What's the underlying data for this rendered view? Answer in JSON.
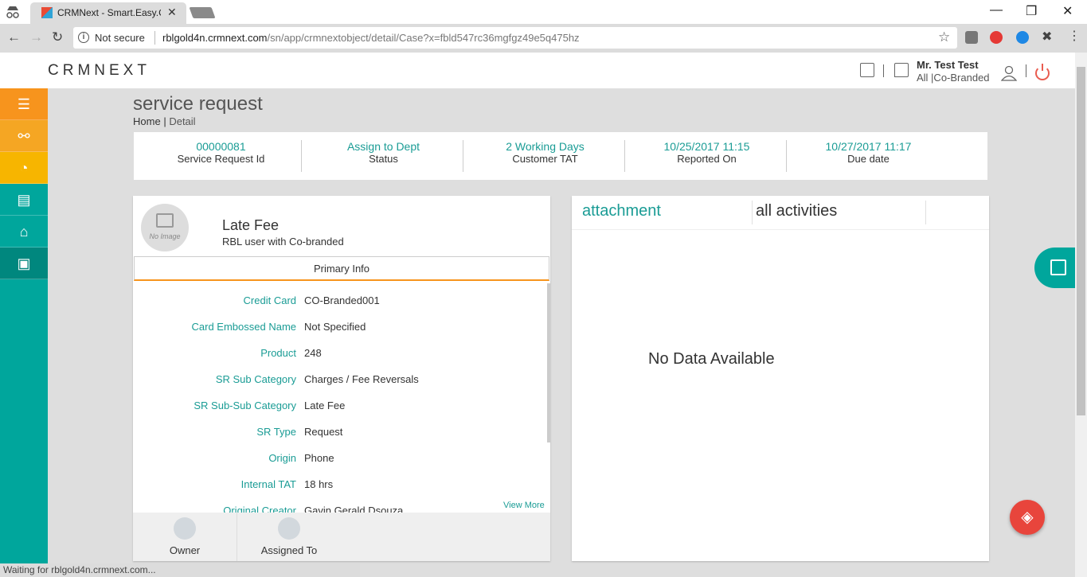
{
  "browser": {
    "tab_title": "CRMNext - Smart.Easy.Co",
    "security": "Not secure",
    "url_host": "rblgold4n.crmnext.com",
    "url_path": "/sn/app/crmnextobject/detail/Case?x=fbld547rc36mgfgz49e5q475hz",
    "status_text": "Waiting for rblgold4n.crmnext.com..."
  },
  "header": {
    "logo": "CRMNEXT",
    "user_name": "Mr. Test Test",
    "user_role": "All |Co-Branded"
  },
  "page": {
    "title": "service request",
    "breadcrumb_home": "Home",
    "breadcrumb_sep": "|",
    "breadcrumb_current": "Detail"
  },
  "summary": [
    {
      "value": "00000081",
      "label": "Service Request Id"
    },
    {
      "value": "Assign to Dept",
      "label": "Status"
    },
    {
      "value": "2 Working Days",
      "label": "Customer TAT"
    },
    {
      "value": "10/25/2017 11:15",
      "label": "Reported On"
    },
    {
      "value": "10/27/2017 11:17",
      "label": "Due date"
    }
  ],
  "record": {
    "no_image": "No Image",
    "subject": "Late Fee",
    "subtitle": "RBL user with Co-branded",
    "tab": "Primary Info",
    "fields": [
      {
        "label": "Credit Card",
        "value": "CO-Branded001"
      },
      {
        "label": "Card Embossed Name",
        "value": "Not Specified"
      },
      {
        "label": "Product",
        "value": "248"
      },
      {
        "label": "SR Sub Category",
        "value": "Charges / Fee Reversals"
      },
      {
        "label": "SR Sub-Sub Category",
        "value": "Late Fee"
      },
      {
        "label": "SR Type",
        "value": "Request"
      },
      {
        "label": "Origin",
        "value": "Phone"
      },
      {
        "label": "Internal TAT",
        "value": "18 hrs"
      },
      {
        "label": "Original Creator",
        "value": "Gavin Gerald Dsouza"
      }
    ],
    "view_more": "View More",
    "owner": "Owner",
    "assigned_to": "Assigned To"
  },
  "activity": {
    "tab_attachment": "attachment",
    "tab_all": "all activities",
    "empty": "No Data Available"
  },
  "colors": {
    "accent": "#1a9c95",
    "sidebar": "#00a69c",
    "orange": "#f7941d",
    "fab": "#e8453c"
  }
}
